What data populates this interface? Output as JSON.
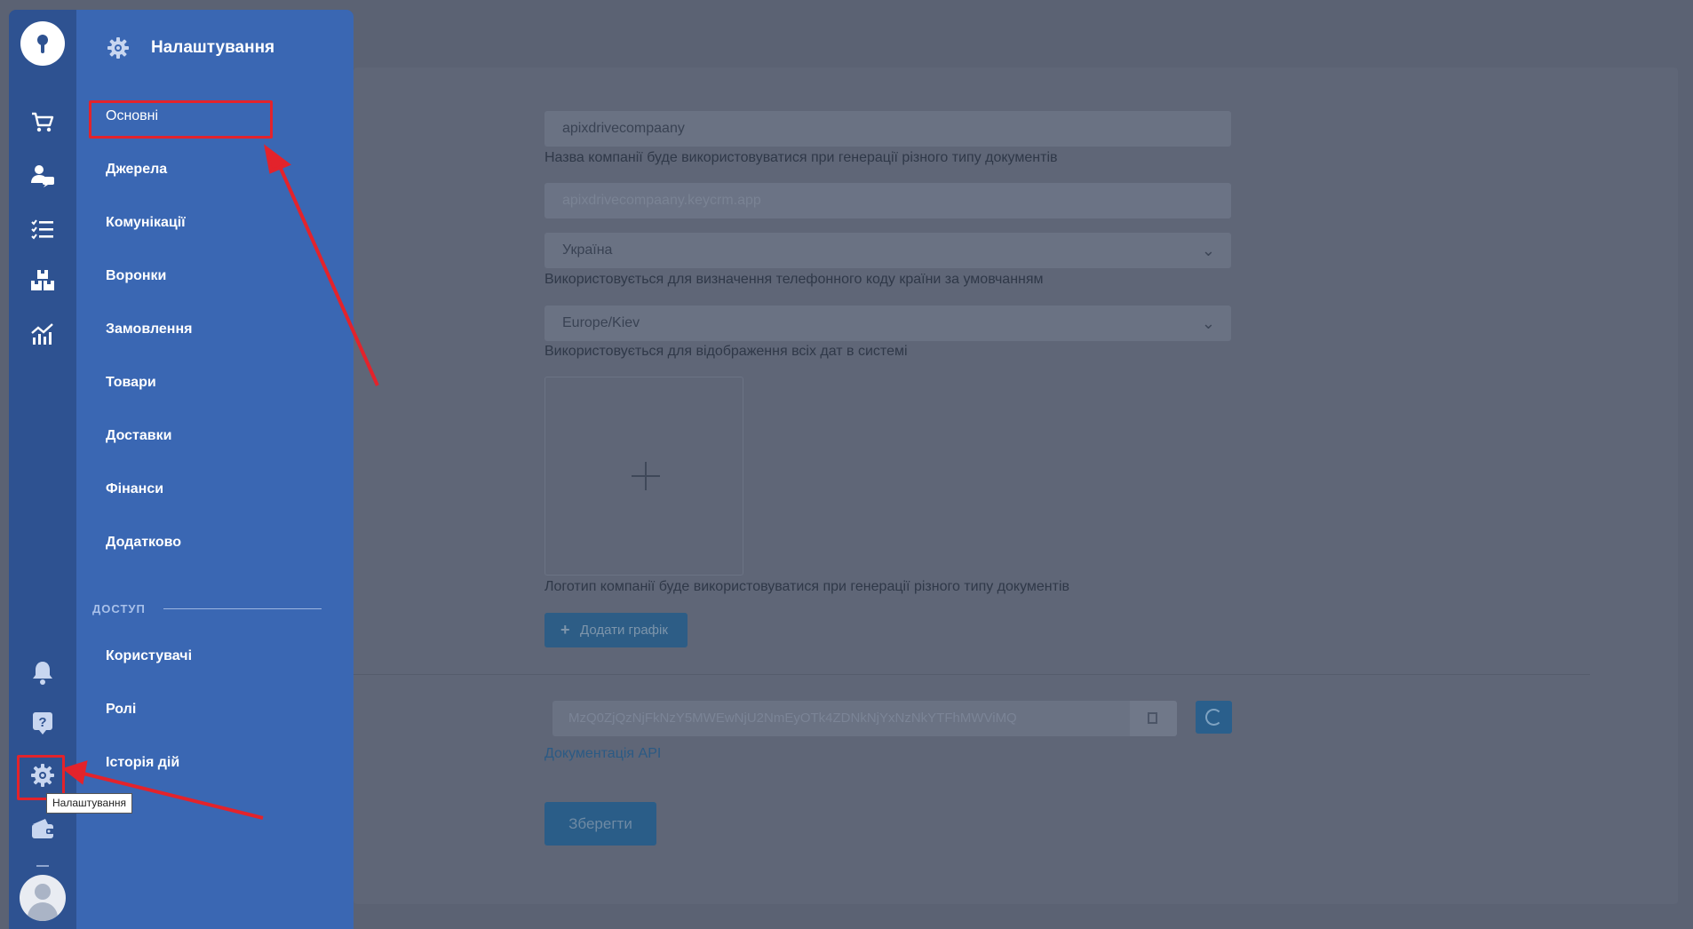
{
  "colors": {
    "rail": "#2e5291",
    "menu": "#3a67b3",
    "overlay_bg": "#5b6273",
    "annotation": "#e3232b",
    "button_dim": "#2a5d88"
  },
  "rail": {
    "icons": [
      "logo-key-icon",
      "cart-icon",
      "contacts-chat-icon",
      "checklist-icon",
      "boxes-icon",
      "analytics-chart-icon",
      "bell-icon",
      "help-icon",
      "gear-icon",
      "wallet-icon",
      "avatar-icon"
    ],
    "tooltip": "Налаштування"
  },
  "menu": {
    "title": "Налаштування",
    "items": [
      {
        "label": "Основні"
      },
      {
        "label": "Джерела"
      },
      {
        "label": "Комунікації"
      },
      {
        "label": "Воронки"
      },
      {
        "label": "Замовлення"
      },
      {
        "label": "Товари"
      },
      {
        "label": "Доставки"
      },
      {
        "label": "Фінанси"
      },
      {
        "label": "Додатково"
      }
    ],
    "access_section": {
      "label": "ДОСТУП",
      "items": [
        {
          "label": "Користувачі"
        },
        {
          "label": "Ролі"
        },
        {
          "label": "Історія дій"
        }
      ]
    }
  },
  "form": {
    "company_name": "apixdrivecompaany",
    "company_name_hint": "Назва компанії буде використовуватися при генерації різного типу документів",
    "domain": "apixdrivecompaany.keycrm.app",
    "country": "Україна",
    "country_hint": "Використовується для визначення телефонного коду країни за умовчанням",
    "timezone": "Europe/Kiev",
    "timezone_hint": "Використовується для відображення всіх дат в системі",
    "logo_hint": "Логотип компанії буде використовуватися при генерації різного типу документів",
    "add_schedule_label": "Додати графік",
    "api_key": "MzQ0ZjQzNjFkNzY5MWEwNjU2NmEyOTk4ZDNkNjYxNzNkYTFhMWViMQ",
    "api_docs_label": "Документація API",
    "save_label": "Зберегти"
  }
}
